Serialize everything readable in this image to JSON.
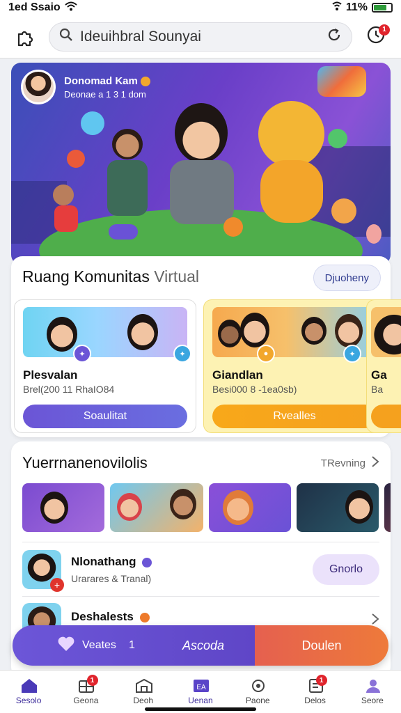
{
  "status": {
    "time": "1ed Ssaio",
    "battery": "11%",
    "battery_level": 0.11
  },
  "search": {
    "value": "Ideuihbral Sounyai",
    "placeholder": ""
  },
  "notifications": {
    "count": "1"
  },
  "hero": {
    "name": "Donomad Kam",
    "subtitle": "Deonae a 1 3 1 dom"
  },
  "community": {
    "title_main": "Ruang Komunitas",
    "title_muted": "Virtual",
    "action_label": "Djuoheny",
    "cards": [
      {
        "title": "Plesvalan",
        "subtitle": "Brel(200 11 RhaIO84",
        "cta": "Soaulitat",
        "cta_color": "#6b55d6"
      },
      {
        "title": "Giandlan",
        "subtitle": "Besi000 8 -1ea0sb)",
        "cta": "Rvealles",
        "cta_color": "#f4a21b"
      },
      {
        "title": "Ga",
        "subtitle": "Ba"
      }
    ]
  },
  "section2": {
    "title": "Yuerrnanenovilolis",
    "link_label": "TRevning",
    "rows": [
      {
        "title": "Nlonathang",
        "subtitle": "Urarares & Tranal)",
        "button": "Gnorlo"
      },
      {
        "title": "Deshalests",
        "subtitle": ""
      }
    ]
  },
  "action_bar": {
    "left_label": "Veates",
    "left_count": "1",
    "center_label": "Ascoda",
    "right_label": "Doulen"
  },
  "bottom_nav": [
    {
      "label": "Sesolo",
      "badge": ""
    },
    {
      "label": "Geona",
      "badge": "1"
    },
    {
      "label": "Deoh",
      "badge": ""
    },
    {
      "label": "Uenan",
      "badge": ""
    },
    {
      "label": "Paone",
      "badge": ""
    },
    {
      "label": "Delos",
      "badge": "1"
    },
    {
      "label": "Seore",
      "badge": ""
    }
  ]
}
